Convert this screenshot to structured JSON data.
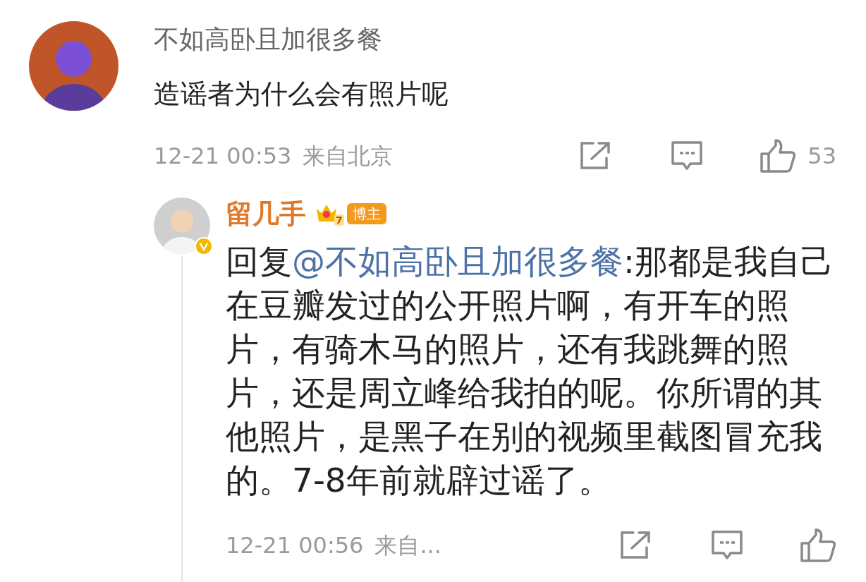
{
  "comment": {
    "author": "不如高卧且加很多餐",
    "text": "造谣者为什么会有照片呢",
    "time": "12-21 00:53",
    "location": "来自北京",
    "likes": "53"
  },
  "reply": {
    "author": "留几手",
    "badge_level": "7",
    "badge": "博主",
    "verified": true,
    "prefix": "回复",
    "mention": "@不如高卧且加很多餐",
    "text": ":那都是我自己在豆瓣发过的公开照片啊，有开车的照片，有骑木马的照片，还有我跳舞的照片，还是周立峰给我拍的呢。你所谓的其他照片，是黑子在别的视频里截图冒充我的。7-8年前就辟过谣了。",
    "time": "12-21 00:56",
    "location": "来自..."
  }
}
